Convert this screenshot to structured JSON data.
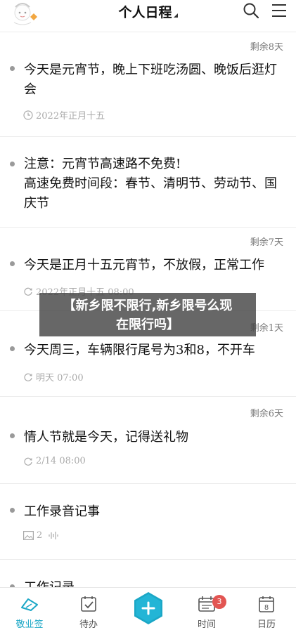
{
  "header": {
    "title": "个人日程"
  },
  "items": [
    {
      "remain": "剩余8天",
      "text": "今天是元宵节，晚上下班吃汤圆、晚饭后逛灯会",
      "meta": "2022年正月十五",
      "meta_icon": "clock-icon"
    },
    {
      "remain": "",
      "text": "注意：元宵节高速路不免费!\n高速免费时间段：春节、清明节、劳动节、国庆节",
      "meta": "",
      "meta_icon": ""
    },
    {
      "remain": "剩余7天",
      "text": "今天是正月十五元宵节，不放假，正常工作",
      "meta": "2022年正月十五  08:00",
      "meta_icon": "repeat-alarm-icon"
    },
    {
      "remain": "剩余1天",
      "text": "今天周三，车辆限行尾号为3和8，不开车",
      "meta": "明天  07:00",
      "meta_icon": "repeat-alarm-icon"
    },
    {
      "remain": "剩余6天",
      "text": "情人节就是今天，记得送礼物",
      "meta": "2/14  08:00",
      "meta_icon": "repeat-alarm-icon"
    },
    {
      "remain": "",
      "text": "工作录音记事",
      "meta": "2",
      "meta_icon": "image-audio-icon"
    },
    {
      "remain": "",
      "text": "工作记录",
      "meta": "",
      "meta_icon": ""
    }
  ],
  "banner": {
    "line1": "【新乡限不限行,新乡限号么现",
    "line2": "在限行吗】"
  },
  "nav": {
    "items": [
      {
        "label": "敬业签",
        "icon": "memo-logo-icon"
      },
      {
        "label": "待办",
        "icon": "todo-check-icon"
      },
      {
        "label": "",
        "icon": "add-icon"
      },
      {
        "label": "时间",
        "icon": "calendar-time-icon",
        "badge": "3"
      },
      {
        "label": "日历",
        "icon": "calendar-icon"
      }
    ]
  },
  "colors": {
    "accent": "#1ba7c6",
    "badge": "#e25552",
    "text": "#111111",
    "muted": "#aaaaaa"
  }
}
